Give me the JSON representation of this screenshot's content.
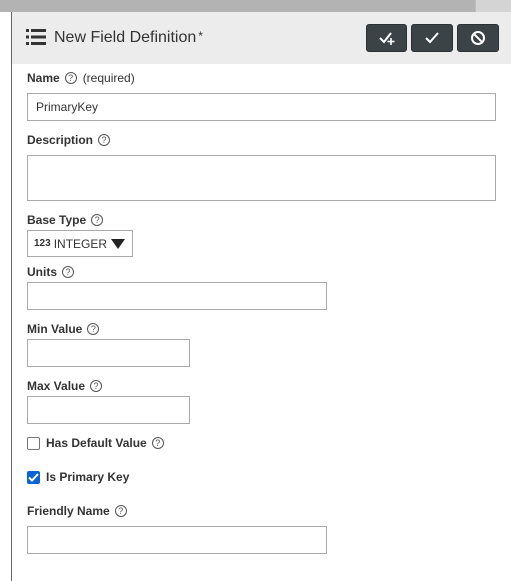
{
  "header": {
    "title": "New Field Definition",
    "dirty_marker": "*",
    "icon": "list-icon",
    "buttons": [
      {
        "name": "save-and-add-button",
        "icon": "check-plus-icon"
      },
      {
        "name": "save-button",
        "icon": "check-icon"
      },
      {
        "name": "cancel-button",
        "icon": "cancel-icon"
      }
    ]
  },
  "form": {
    "name": {
      "label": "Name",
      "required": "(required)",
      "value": "PrimaryKey"
    },
    "description": {
      "label": "Description",
      "value": ""
    },
    "base_type": {
      "label": "Base Type",
      "type_icon": "123",
      "value": "INTEGER"
    },
    "units": {
      "label": "Units",
      "value": ""
    },
    "min_value": {
      "label": "Min Value",
      "value": ""
    },
    "max_value": {
      "label": "Max Value",
      "value": ""
    },
    "has_default": {
      "label": "Has Default Value",
      "checked": false
    },
    "is_primary_key": {
      "label": "Is Primary Key",
      "checked": true
    },
    "friendly_name": {
      "label": "Friendly Name",
      "value": ""
    }
  },
  "help_glyph": "?",
  "colors": {
    "header_bg": "#ececec",
    "button_bg": "#3b4347",
    "checkbox_accent": "#0a64d8"
  }
}
